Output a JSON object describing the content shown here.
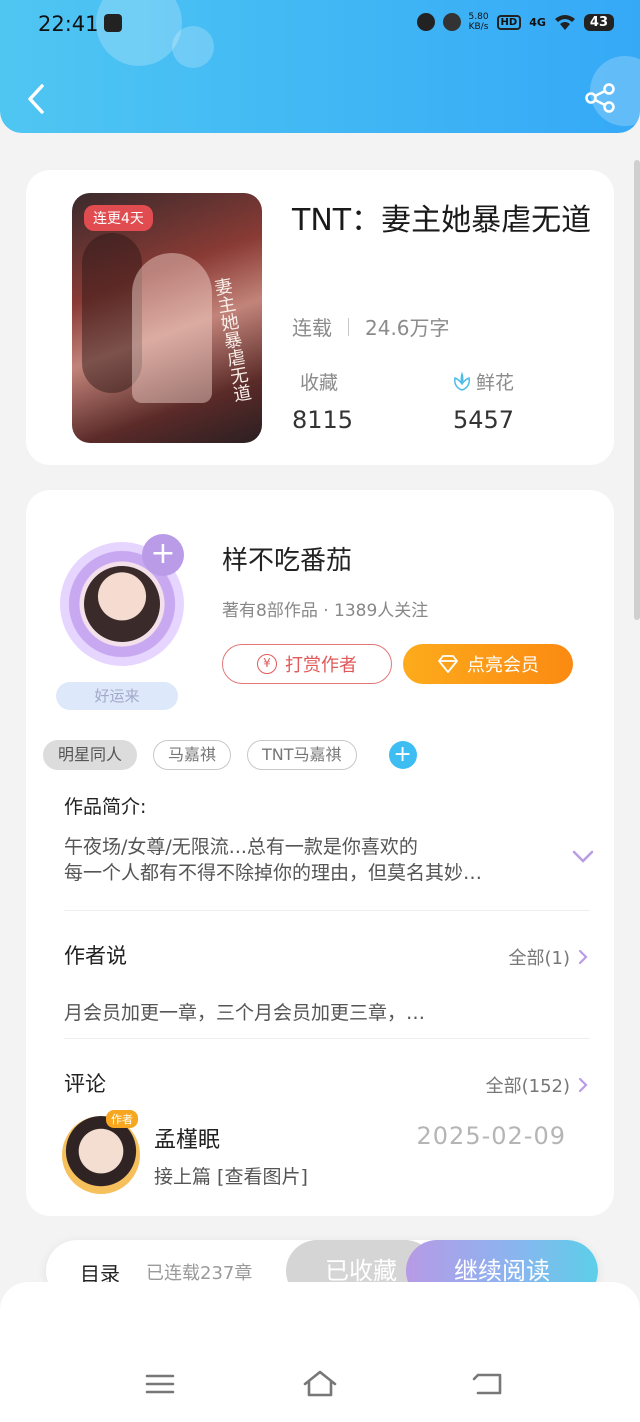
{
  "status_bar": {
    "time": "22:41",
    "net_speed_value": "5.80",
    "net_speed_unit": "KB/s",
    "hd": "HD",
    "signal": "4G",
    "battery": "43"
  },
  "book": {
    "cover_badge": "连更4天",
    "cover_art_title": "妻主她暴虐无道",
    "title": "TNT：妻主她暴虐无道",
    "status": "连载",
    "word_count": "24.6万字",
    "favorites_label": "收藏",
    "favorites_value": "8115",
    "flowers_label": "鲜花",
    "flowers_value": "5457"
  },
  "author": {
    "name": "样不吃番茄",
    "info": "著有8部作品 · 1389人关注",
    "frame_tag": "好运来",
    "tip_button": "打赏作者",
    "vip_button": "点亮会员"
  },
  "tags": [
    "明星同人",
    "马嘉祺",
    "TNT马嘉祺"
  ],
  "intro": {
    "title": "作品简介:",
    "line1": "午夜场/女尊/无限流...总有一款是你喜欢的",
    "line2": "每一个人都有不得不除掉你的理由，但莫名其妙…"
  },
  "author_says": {
    "title": "作者说",
    "more": "全部(1)",
    "text": "月会员加更一章，三个月会员加更三章，…"
  },
  "comments": {
    "title": "评论",
    "more": "全部(152)",
    "items": [
      {
        "badge": "作者",
        "name": "孟槿眠",
        "date": "2025-02-09",
        "text": "接上篇  [查看图片]"
      }
    ]
  },
  "action_bar": {
    "toc": "目录",
    "serial_info": "已连载237章",
    "faved": "已收藏",
    "continue": "继续阅读"
  },
  "colors": {
    "header": "#3fb5f5",
    "vip": "#fb8a12",
    "tip": "#e05a5a",
    "accent_purple": "#b99be8"
  }
}
